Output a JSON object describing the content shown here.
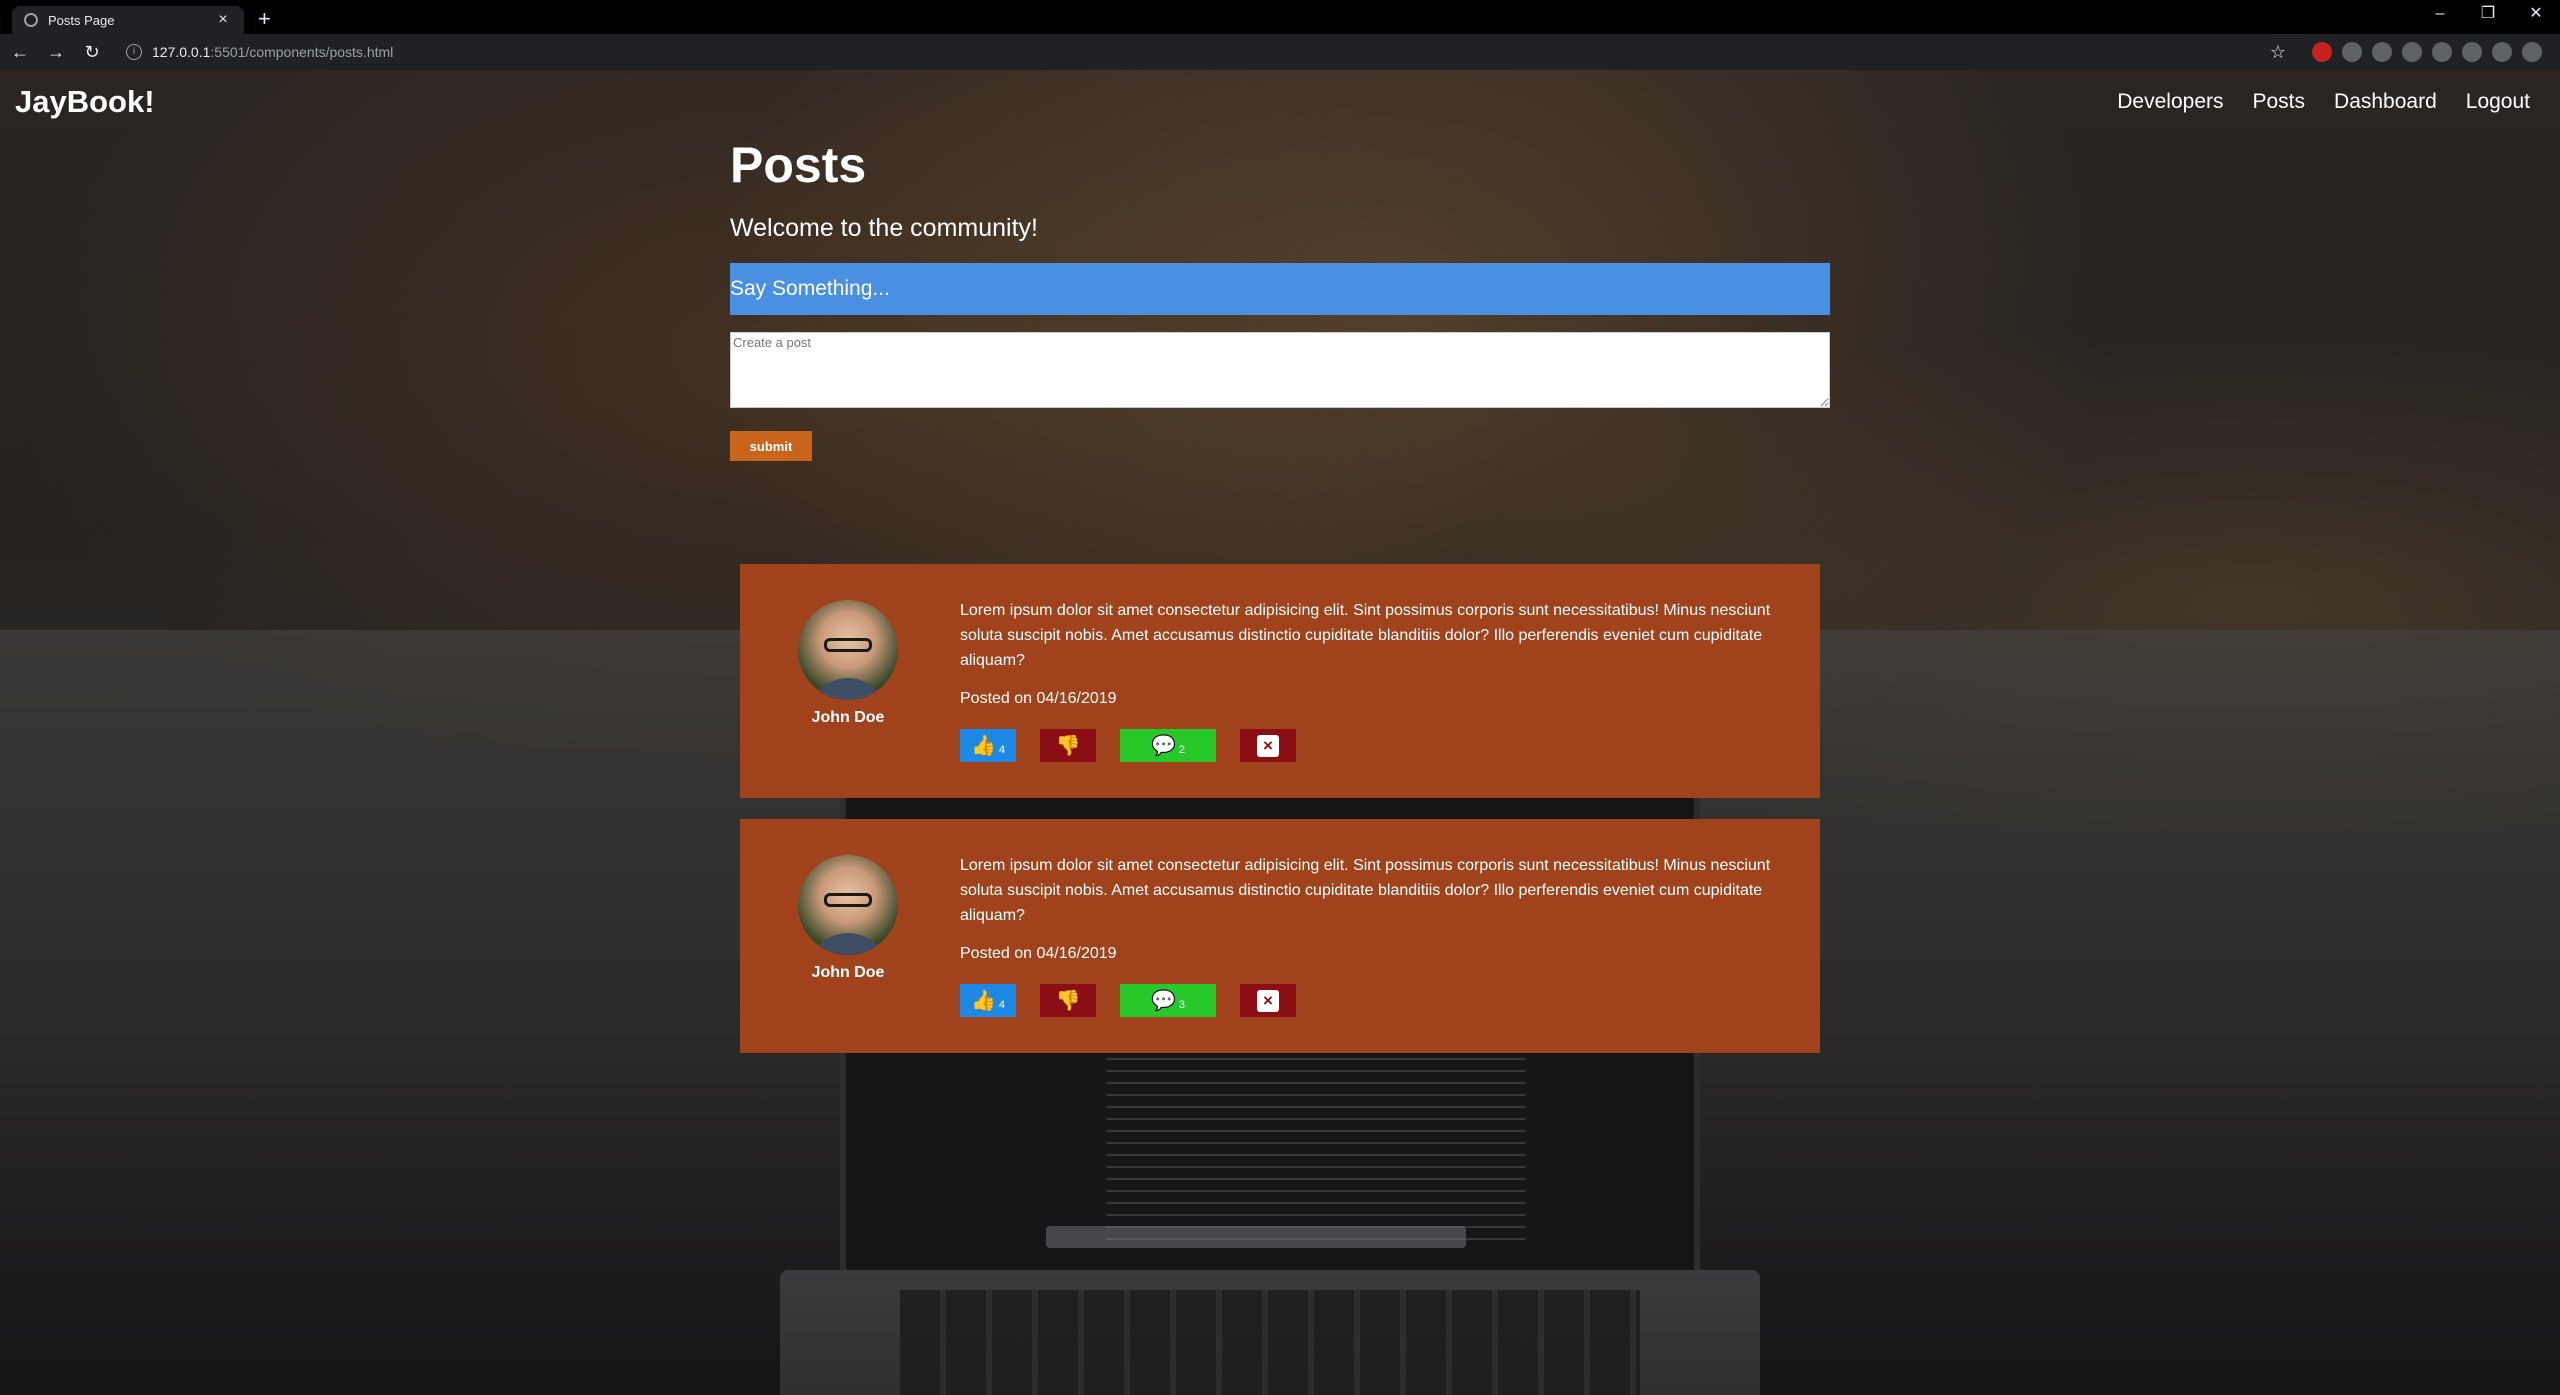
{
  "browser": {
    "tab_title": "Posts Page",
    "tab_close": "×",
    "new_tab": "+",
    "url_host": "127.0.0.1",
    "url_path": ":5501/components/posts.html",
    "win_min": "–",
    "win_restore": "❐",
    "win_close": "✕"
  },
  "site": {
    "brand": "JayBook!",
    "nav": [
      "Developers",
      "Posts",
      "Dashboard",
      "Logout"
    ]
  },
  "page": {
    "title": "Posts",
    "lead": "Welcome to the community!",
    "say_something": "Say Something...",
    "textarea_placeholder": "Create a post",
    "submit_label": "submit"
  },
  "posts": [
    {
      "author": "John Doe",
      "text": "Lorem ipsum dolor sit amet consectetur adipisicing elit. Sint possimus corporis sunt necessitatibus! Minus nesciunt soluta suscipit nobis. Amet accusamus distinctio cupiditate blanditiis dolor? Illo perferendis eveniet cum cupiditate aliquam?",
      "date": "Posted on 04/16/2019",
      "likes": "4",
      "comments": "2"
    },
    {
      "author": "John Doe",
      "text": "Lorem ipsum dolor sit amet consectetur adipisicing elit. Sint possimus corporis sunt necessitatibus! Minus nesciunt soluta suscipit nobis. Amet accusamus distinctio cupiditate blanditiis dolor? Illo perferendis eveniet cum cupiditate aliquam?",
      "date": "Posted on 04/16/2019",
      "likes": "4",
      "comments": "3"
    }
  ],
  "icons": {
    "like": "thumbs-up-icon",
    "dislike": "thumbs-down-icon",
    "comment": "comments-icon",
    "delete": "close-icon"
  },
  "colors": {
    "post_bg": "#a0421c",
    "say_bar": "#4a90e2",
    "submit": "#c8641c",
    "like": "#1e88e5",
    "dislike": "#8b0e14",
    "comment": "#27c92a"
  }
}
